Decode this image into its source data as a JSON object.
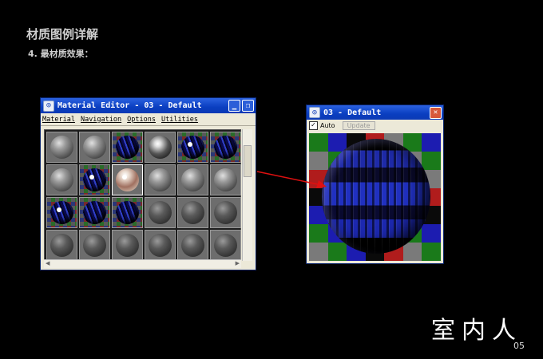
{
  "slide": {
    "title": "材质图例详解",
    "subtitle": "4. 最材质效果：",
    "logo": "室内人",
    "page_number": "05"
  },
  "material_editor": {
    "title": "Material Editor - 03 - Default",
    "menu": [
      "Material",
      "Navigation",
      "Options",
      "Utilities"
    ],
    "slots": [
      "grey",
      "grey",
      "blue-checker",
      "chrome",
      "checker-spec",
      "blue-checker",
      "grey",
      "checker-spec",
      "glass-active",
      "grey",
      "grey",
      "grey",
      "checker-spec",
      "blue-checker",
      "blue-checker",
      "dark",
      "dark",
      "dark",
      "dark",
      "dark",
      "dark",
      "dark",
      "dark",
      "dark"
    ]
  },
  "preview": {
    "title": "03 - Default",
    "auto_label": "Auto",
    "auto_checked": true,
    "update_label": "Update",
    "checker_colors": [
      "#1a7a1a",
      "#b01c1c",
      "#1c1cb0",
      "#7a7a7a",
      "#0a0a0a"
    ]
  },
  "colors": {
    "titlebar": "#0a3ec0",
    "arrow": "#e01010"
  }
}
